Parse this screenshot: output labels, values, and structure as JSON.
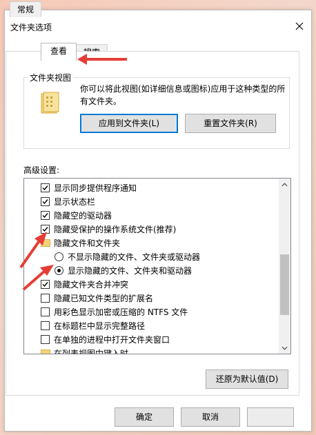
{
  "window": {
    "title": "文件夹选项",
    "close_icon": "close-icon"
  },
  "tabs": [
    {
      "label": "常规"
    },
    {
      "label": "查看"
    },
    {
      "label": "搜索"
    }
  ],
  "folder_views": {
    "heading": "文件夹视图",
    "description": "你可以将此视图(如详细信息或图标)应用于这种类型的所有文件夹。",
    "apply_button": "应用到文件夹(L)",
    "reset_button": "重置文件夹(R)"
  },
  "advanced": {
    "heading": "高级设置:",
    "items": [
      {
        "type": "checkbox",
        "checked": true,
        "label": "显示同步提供程序通知"
      },
      {
        "type": "checkbox",
        "checked": true,
        "label": "显示状态栏"
      },
      {
        "type": "checkbox",
        "checked": true,
        "label": "隐藏空的驱动器"
      },
      {
        "type": "checkbox",
        "checked": true,
        "label": "隐藏受保护的操作系统文件(推荐)"
      },
      {
        "type": "folder",
        "label": "隐藏文件和文件夹"
      },
      {
        "type": "radio",
        "checked": false,
        "label": "不显示隐藏的文件、文件夹或驱动器"
      },
      {
        "type": "radio",
        "checked": true,
        "label": "显示隐藏的文件、文件夹和驱动器"
      },
      {
        "type": "checkbox",
        "checked": true,
        "label": "隐藏文件夹合并冲突"
      },
      {
        "type": "checkbox",
        "checked": false,
        "label": "隐藏已知文件类型的扩展名"
      },
      {
        "type": "checkbox",
        "checked": false,
        "label": "用彩色显示加密或压缩的 NTFS 文件"
      },
      {
        "type": "checkbox",
        "checked": false,
        "label": "在标题栏中显示完整路径"
      },
      {
        "type": "checkbox",
        "checked": false,
        "label": "在单独的进程中打开文件夹窗口"
      },
      {
        "type": "folder",
        "label": "在列表视图中键入时"
      }
    ],
    "restore_button": "还原为默认值(D)"
  },
  "footer": {
    "ok": "确定",
    "cancel": "取消"
  },
  "colors": {
    "annotation_arrow": "#e53d35",
    "focus_border": "#0078d7"
  }
}
